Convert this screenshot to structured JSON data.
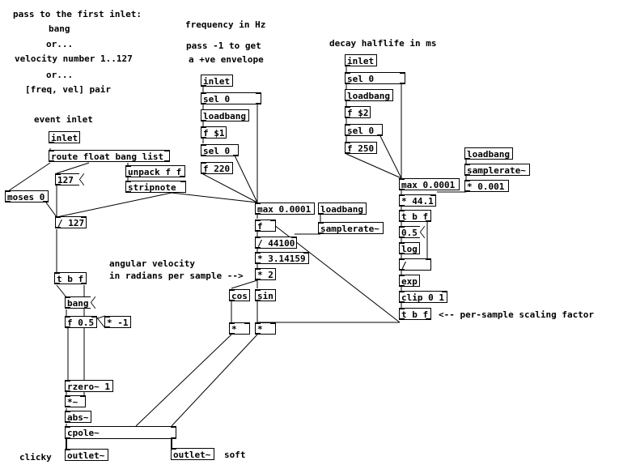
{
  "comments": {
    "pass_first_inlet": "pass to the first inlet:",
    "bang": "bang",
    "or1": "or...",
    "velocity": "velocity number 1..127",
    "or2": "or...",
    "freq_vel_pair": "[freq, vel] pair",
    "event_inlet": "event inlet",
    "frequency_hz": "frequency in Hz",
    "pass_neg1": "pass -1 to get",
    "positive_env": "a +ve envelope",
    "decay_halflife": "decay halflife in ms",
    "angular_velocity": "angular velocity",
    "radians_per_sample": "in radians per sample -->",
    "per_sample_scaling": "<-- per-sample scaling factor",
    "clicky": "clicky",
    "soft": "soft"
  },
  "objects": {
    "inlet_event": "inlet",
    "route": "route float bang list",
    "unpack": "unpack f f",
    "stripnote": "stripnote",
    "msg_127": "127",
    "moses": "moses 0",
    "div127": "/ 127",
    "tbf_left": "t b f",
    "msg_bang": "bang",
    "f_05": "f 0.5",
    "mul_neg1": "* -1",
    "rzero": "rzero~ 1",
    "mul_sig": "*~",
    "abs": "abs~",
    "cpole": "cpole~",
    "outlet_clicky": "outlet~",
    "outlet_soft": "outlet~",
    "inlet_freq": "inlet",
    "sel0_freq_a": "sel 0",
    "loadbang_freq": "loadbang",
    "f_dollar1": "f $1",
    "sel0_freq_b": "sel 0",
    "f_220": "f 220",
    "max_freq": "max 0.0001",
    "loadbang_sr1": "loadbang",
    "samplerate1": "samplerate~",
    "f_plain": "f",
    "div44100": "/ 44100",
    "mul_pi": "* 3.14159",
    "mul_2": "* 2",
    "cos": "cos",
    "sin": "sin",
    "mul_cos": "*",
    "mul_sin": "*",
    "inlet_decay": "inlet",
    "sel0_decay_a": "sel 0",
    "loadbang_decay": "loadbang",
    "f_dollar2": "f $2",
    "sel0_decay_b": "sel 0",
    "f_250": "f 250",
    "max_decay": "max 0.0001",
    "loadbang_sr2": "loadbang",
    "samplerate2": "samplerate~",
    "mul_0001": "* 0.001",
    "mul_441": "* 44.1",
    "tbf_right": "t b f",
    "msg_05": "0.5",
    "log": "log",
    "div": "/",
    "exp": "exp",
    "clip": "clip 0 1",
    "tbf_scale": "t b f"
  }
}
